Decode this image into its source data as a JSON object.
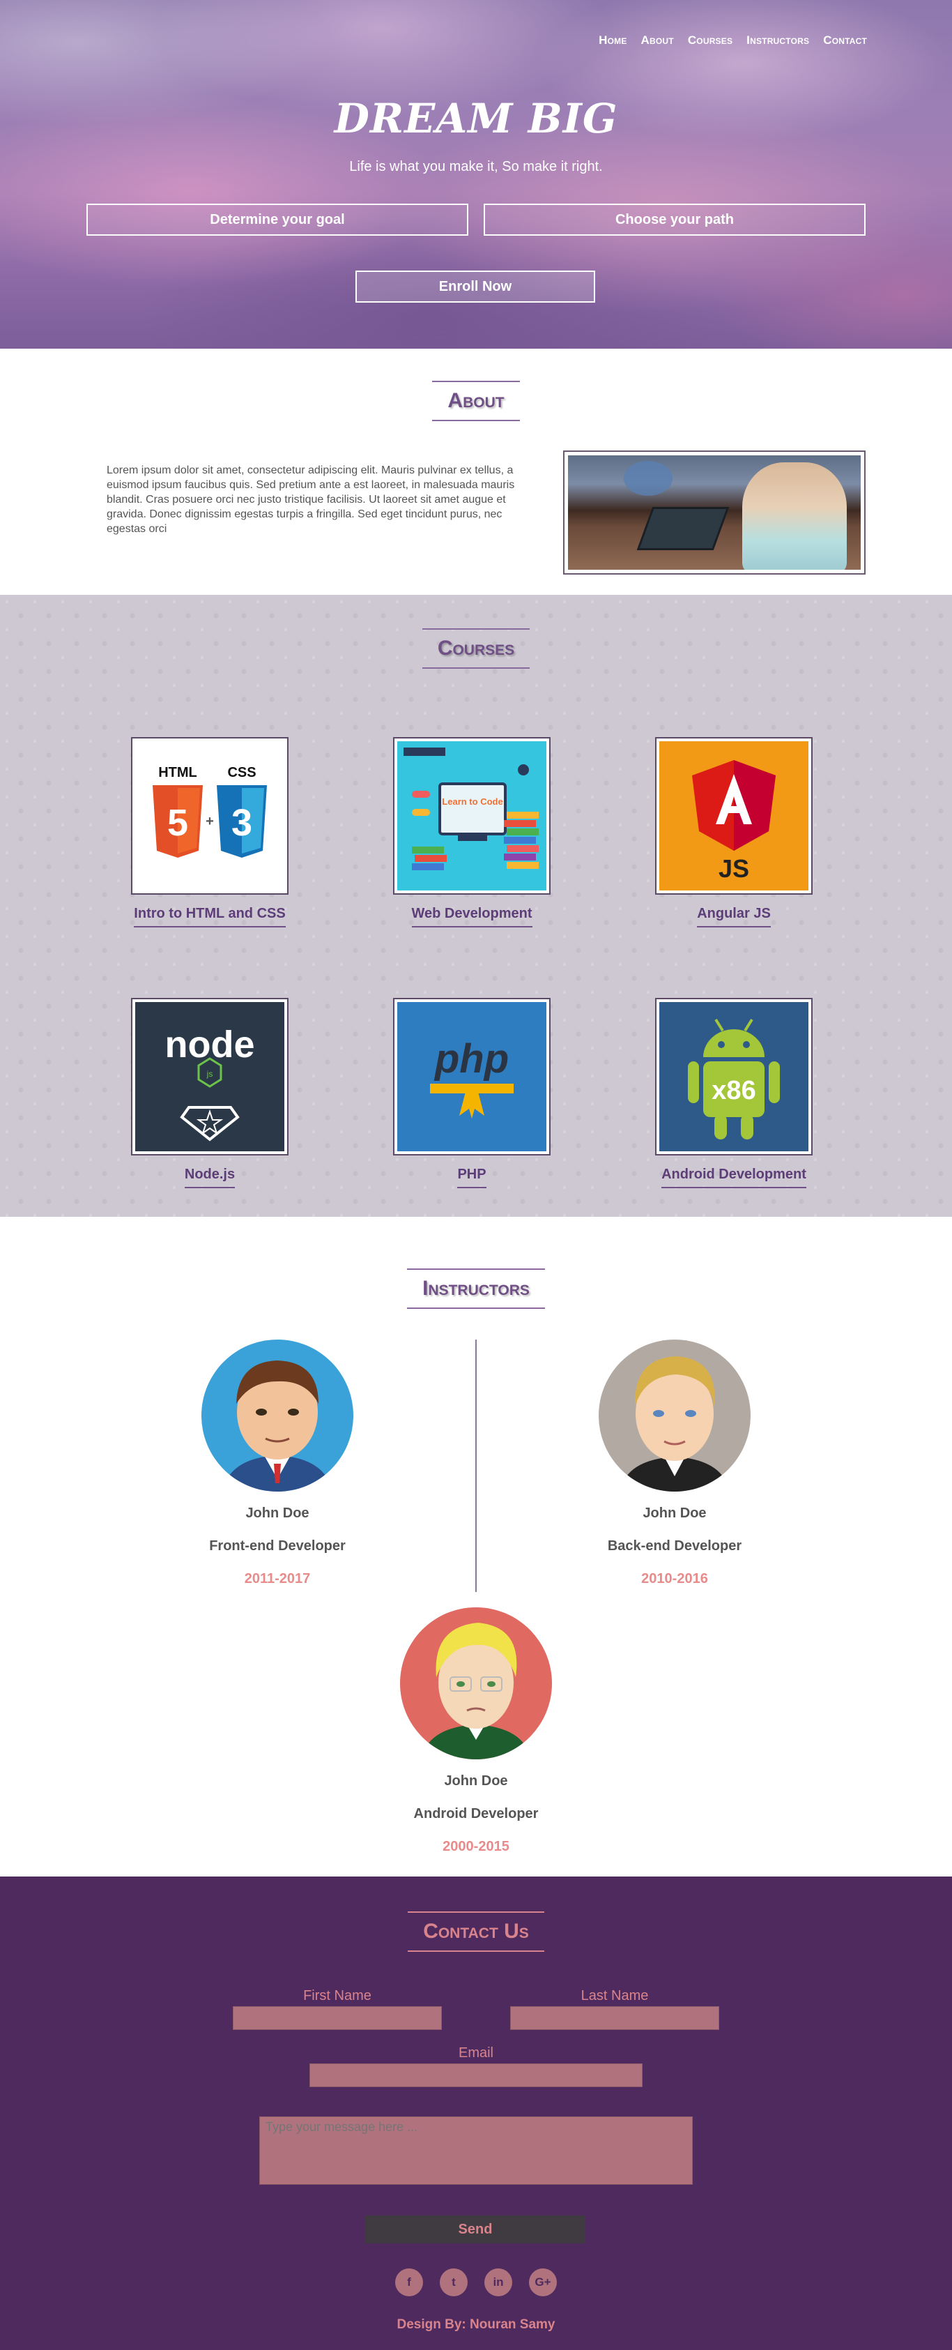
{
  "nav": {
    "items": [
      "Home",
      "About",
      "Courses",
      "Instructors",
      "Contact"
    ]
  },
  "hero": {
    "title": "DREAM BIG",
    "subtitle": "Life is what you make it, So make it right.",
    "goal_button": "Determine your goal",
    "path_button": "Choose your path",
    "enroll_button": "Enroll Now"
  },
  "about": {
    "title": "About",
    "text": "Lorem ipsum dolor sit amet, consectetur adipiscing elit. Mauris pulvinar ex tellus, a euismod ipsum faucibus quis. Sed pretium ante a est laoreet, in malesuada mauris blandit. Cras posuere orci nec justo tristique facilisis. Ut laoreet sit amet augue et gravida. Donec dignissim egestas turpis a fringilla. Sed eget tincidunt purus, nec egestas orci"
  },
  "courses": {
    "title": "Courses",
    "items": [
      {
        "label": "Intro to HTML and CSS",
        "icon": "html-css-logo",
        "bg": "#ffffff"
      },
      {
        "label": "Web Development",
        "icon": "learn-to-code-illustration",
        "bg": "#35c5df",
        "text": "Learn to Code"
      },
      {
        "label": "Angular JS",
        "icon": "angular-logo",
        "bg": "#f29916",
        "text": "JS"
      },
      {
        "label": "Node.js",
        "icon": "nodejs-logo",
        "bg": "#2b3848",
        "text": "node"
      },
      {
        "label": "PHP",
        "icon": "php-logo",
        "bg": "#2f7dc1",
        "text": "php"
      },
      {
        "label": "Android Development",
        "icon": "android-x86-logo",
        "bg": "#2e5a8a",
        "text": "x86"
      }
    ]
  },
  "instructors": {
    "title": "Instructors",
    "items": [
      {
        "name": "John Doe",
        "role": "Front-end Developer",
        "years": "2011-2017"
      },
      {
        "name": "John Doe",
        "role": "Back-end Developer",
        "years": "2010-2016"
      },
      {
        "name": "John Doe",
        "role": "Android Developer",
        "years": "2000-2015"
      }
    ]
  },
  "contact": {
    "title": "Contact Us",
    "first_name_label": "First Name",
    "last_name_label": "Last Name",
    "email_label": "Email",
    "message_placeholder": "Type your message here ...",
    "send_button": "Send",
    "socials": [
      "f",
      "t",
      "in",
      "G+"
    ],
    "credit": "Design By: Nouran Samy"
  },
  "colors": {
    "accent": "#6f4f86",
    "contact_bg": "#4e2a5e",
    "contact_accent": "#d9848c"
  }
}
